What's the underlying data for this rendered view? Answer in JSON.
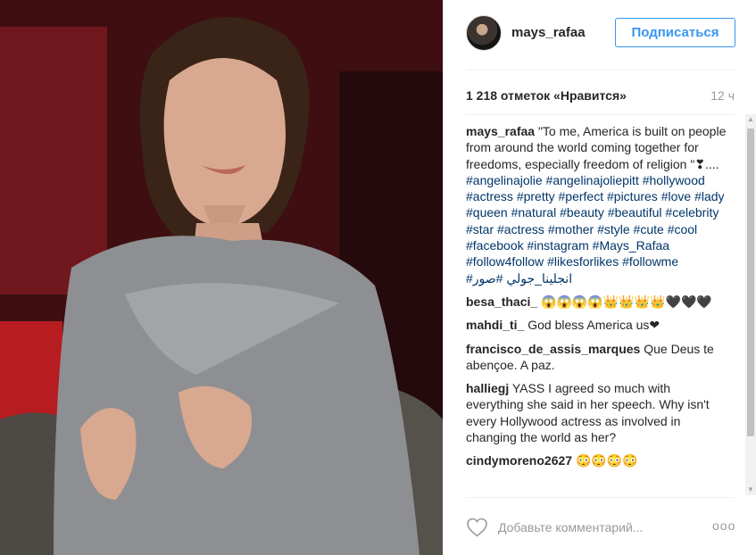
{
  "post": {
    "username": "mays_rafaa",
    "follow_label": "Подписаться",
    "likes": "1 218 отметок «Нравится»",
    "time": "12 ч"
  },
  "caption": {
    "user": "mays_rafaa",
    "text": "\"To me, America is built on people from around the world coming together for freedoms, especially freedom of religion \"❣.... ",
    "hashtags": [
      "#angelinajolie",
      "#angelinajoliepitt",
      "#hollywood",
      "#actress",
      "#pretty",
      "#perfect",
      "#pictures",
      "#love",
      "#lady",
      "#queen",
      "#natural",
      "#beauty",
      "#beautiful",
      "#celebrity",
      "#star",
      "#actress",
      "#mother",
      "#style",
      "#cute",
      "#cool",
      "#facebook",
      "#instagram",
      "#Mays_Rafaa",
      "#follow4follow",
      "#likesforlikes",
      "#followme",
      "#انجلينا_جولي",
      "#صور"
    ]
  },
  "comments": [
    {
      "user": "besa_thaci_",
      "text": "😱😱😱😱👑👑👑👑🖤🖤🖤"
    },
    {
      "user": "mahdi_ti_",
      "text": "God bless America us❤"
    },
    {
      "user": "francisco_de_assis_marques",
      "text": "Que Deus te abençoe. A paz."
    },
    {
      "user": "halliegj",
      "text": "YASS I agreed so much with everything she said in her speech. Why isn't every Hollywood actress as involved in changing the world as her?"
    },
    {
      "user": "cindymoreno2627",
      "text": "😳😳😳😳"
    }
  ],
  "footer": {
    "comment_placeholder": "Добавьте комментарий...",
    "more_label": "ooo"
  },
  "icons": {
    "like": "heart-icon",
    "more": "more-options-icon",
    "scroll_up": "scroll-up-arrow-icon",
    "scroll_down": "scroll-down-arrow-icon"
  },
  "colors": {
    "follow_blue": "#3897f0",
    "hashtag": "#003569",
    "muted": "#999999"
  }
}
